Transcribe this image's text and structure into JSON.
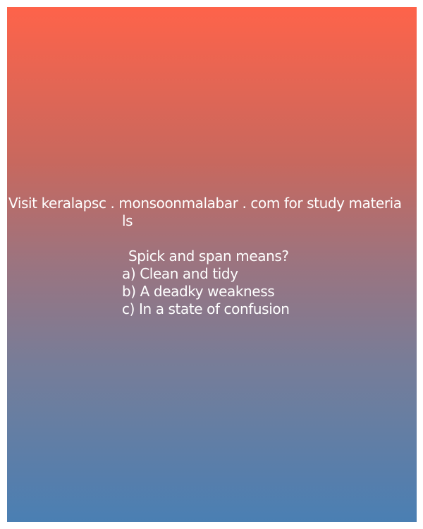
{
  "post": {
    "promo_line": "Visit keralapsc . monsoonmalabar . com for study materia",
    "promo_wrap": "ls",
    "question": "Spick and span means?",
    "options": [
      "a) Clean and tidy",
      "b) A deadky weakness",
      "c) In a state of confusion"
    ]
  },
  "colors": {
    "gradient_top": "#fe634a",
    "gradient_bottom": "#4a7fb3",
    "text": "#ffffff"
  }
}
